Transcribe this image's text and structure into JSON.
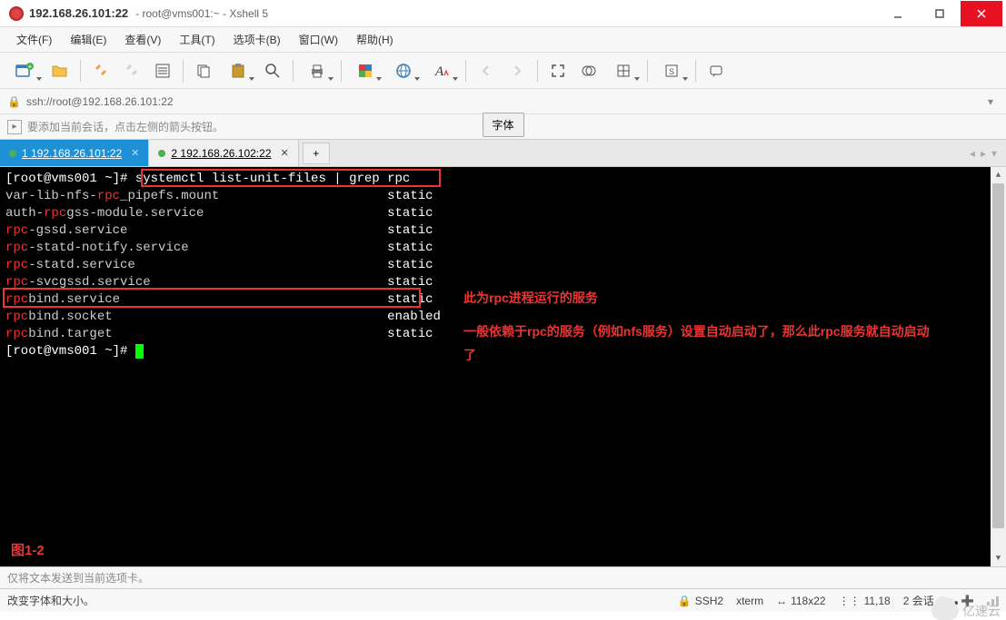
{
  "window": {
    "title_ip": "192.168.26.101:22",
    "title_sub": "root@vms001:~ - Xshell 5"
  },
  "menu": {
    "file": "文件(F)",
    "edit": "编辑(E)",
    "view": "查看(V)",
    "tools": "工具(T)",
    "tabs": "选项卡(B)",
    "window": "窗口(W)",
    "help": "帮助(H)"
  },
  "address": {
    "url": "ssh://root@192.168.26.101:22",
    "font_btn": "字体"
  },
  "hint": {
    "text": "要添加当前会话，点击左侧的箭头按钮。"
  },
  "tabs": {
    "t1_num": "1",
    "t1_label": "192.168.26.101:22",
    "t2_num": "2",
    "t2_label": "192.168.26.102:22",
    "add": "+"
  },
  "terminal": {
    "prompt": "[root@vms001 ~]# ",
    "command": "systemctl list-unit-files | grep rpc",
    "lines": [
      {
        "pre": "var-lib-nfs-",
        "hl": "rpc",
        "post": "_pipefs.mount",
        "state": "static"
      },
      {
        "pre": "auth-",
        "hl": "rpc",
        "post": "gss-module.service",
        "state": "static"
      },
      {
        "pre": "",
        "hl": "rpc",
        "post": "-gssd.service",
        "state": "static"
      },
      {
        "pre": "",
        "hl": "rpc",
        "post": "-statd-notify.service",
        "state": "static"
      },
      {
        "pre": "",
        "hl": "rpc",
        "post": "-statd.service",
        "state": "static"
      },
      {
        "pre": "",
        "hl": "rpc",
        "post": "-svcgssd.service",
        "state": "static"
      },
      {
        "pre": "",
        "hl": "rpc",
        "post": "bind.service",
        "state": "static"
      },
      {
        "pre": "",
        "hl": "rpc",
        "post": "bind.socket",
        "state": "enabled"
      },
      {
        "pre": "",
        "hl": "rpc",
        "post": "bind.target",
        "state": "static"
      }
    ],
    "prompt2": "[root@vms001 ~]# ",
    "annot1": "此为rpc进程运行的服务",
    "annot2": "一般依赖于rpc的服务（例如nfs服务）设置自动启动了，那么此rpc服务就自动启动了",
    "fig_label": "图1-2"
  },
  "sendbar": {
    "text": "仅将文本发送到当前选项卡。"
  },
  "status": {
    "left": "改变字体和大小。",
    "ssh": "SSH2",
    "term": "xterm",
    "size": "118x22",
    "cursor": "11,18",
    "sessions": "2 会话"
  },
  "watermark": {
    "text": "亿速云"
  }
}
